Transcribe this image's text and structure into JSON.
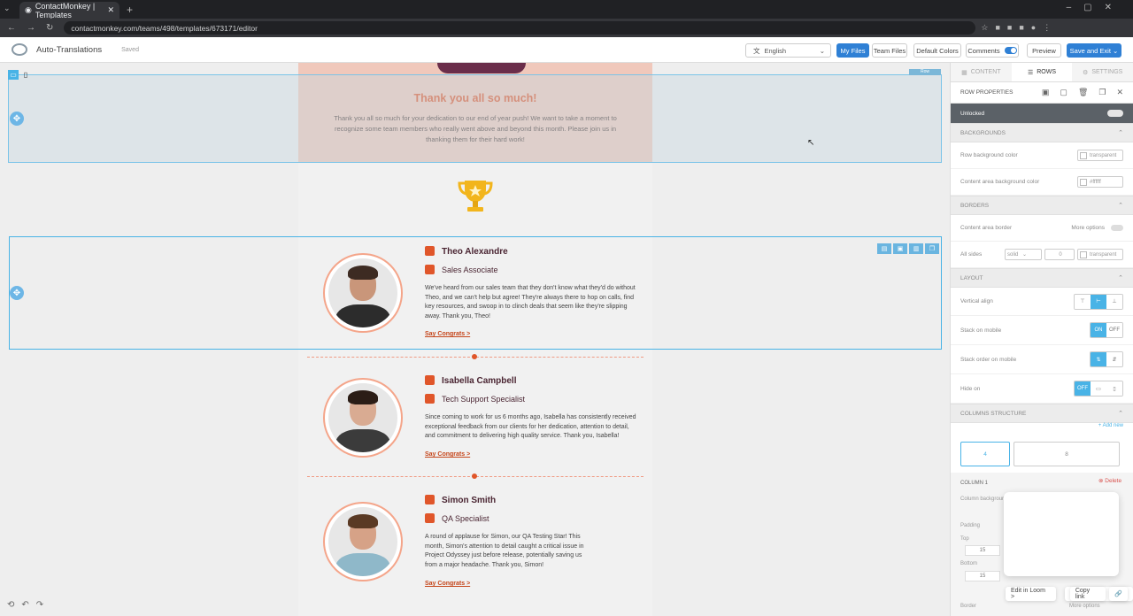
{
  "browser": {
    "tab_title": "ContactMonkey | Templates",
    "url": "contactmonkey.com/teams/498/templates/673171/editor"
  },
  "appbar": {
    "title": "Auto-Translations",
    "status": "Saved",
    "language": "English",
    "buttons": {
      "my_files": "My Files",
      "team_files": "Team Files",
      "default_colors": "Default Colors",
      "comments": "Comments",
      "preview": "Preview",
      "save_exit": "Save and Exit"
    }
  },
  "hero": {
    "heading": "Thank you all so much!",
    "body": "Thank you all so much for your dedication to our end of year push! We want to take a moment to recognize some team members who really went above and beyond this month. Please join us in thanking them for their hard work!"
  },
  "row_tag": "Row",
  "people": [
    {
      "name": "Theo Alexandre",
      "role": "Sales Associate",
      "desc": "We've heard from our sales team that they don't know what they'd do without Theo, and we can't help but agree! They're always there to hop on calls, find key resources, and swoop in to clinch deals that seem like they're slipping away. Thank you, Theo!",
      "link": "Say Congrats >"
    },
    {
      "name": "Isabella Campbell",
      "role": "Tech Support Specialist",
      "desc": "Since coming to work for us 6 months ago, Isabella has consistently received exceptional feedback from our clients for her dedication, attention to detail, and commitment to delivering high quality service. Thank you, Isabella!",
      "link": "Say Congrats >"
    },
    {
      "name": "Simon Smith",
      "role": "QA Specialist",
      "desc": "A round of applause for Simon, our QA Testing Star! This month, Simon's attention to detail caught a critical issue in Project Odyssey just before release, potentially saving us from a major headache. Thank you, Simon!",
      "link": "Say Congrats >"
    }
  ],
  "panel": {
    "tabs": [
      "CONTENT",
      "ROWS",
      "SETTINGS"
    ],
    "header": "ROW PROPERTIES",
    "unlocked": "Unlocked",
    "backgrounds": {
      "title": "BACKGROUNDS",
      "row_bg_label": "Row background color",
      "row_bg_value": "transparent",
      "content_bg_label": "Content area background color",
      "content_bg_value": "#ffffff"
    },
    "borders": {
      "title": "BORDERS",
      "content_border_label": "Content area border",
      "more_options": "More options",
      "all_sides_label": "All sides",
      "style": "solid",
      "width": "0",
      "color": "transparent"
    },
    "layout": {
      "title": "LAYOUT",
      "vertical_align": "Vertical align",
      "stack_on_mobile": "Stack on mobile",
      "on": "ON",
      "off": "OFF",
      "stack_order": "Stack order on mobile",
      "hide_on": "Hide on",
      "hide_off": "OFF"
    },
    "columns": {
      "title": "COLUMNS STRUCTURE",
      "add_new": "+ Add new",
      "col1": "4",
      "col2": "8"
    },
    "column1": {
      "title": "COLUMN 1",
      "delete": "Delete",
      "bg_label": "Column background",
      "padding": "Padding",
      "top": "Top",
      "top_val": "15",
      "bottom": "Bottom",
      "bottom_val": "15",
      "border": "Border",
      "more_options": "More options"
    },
    "popup": {
      "edit_loom": "Edit in Loom >",
      "copy_link": "Copy link"
    }
  }
}
